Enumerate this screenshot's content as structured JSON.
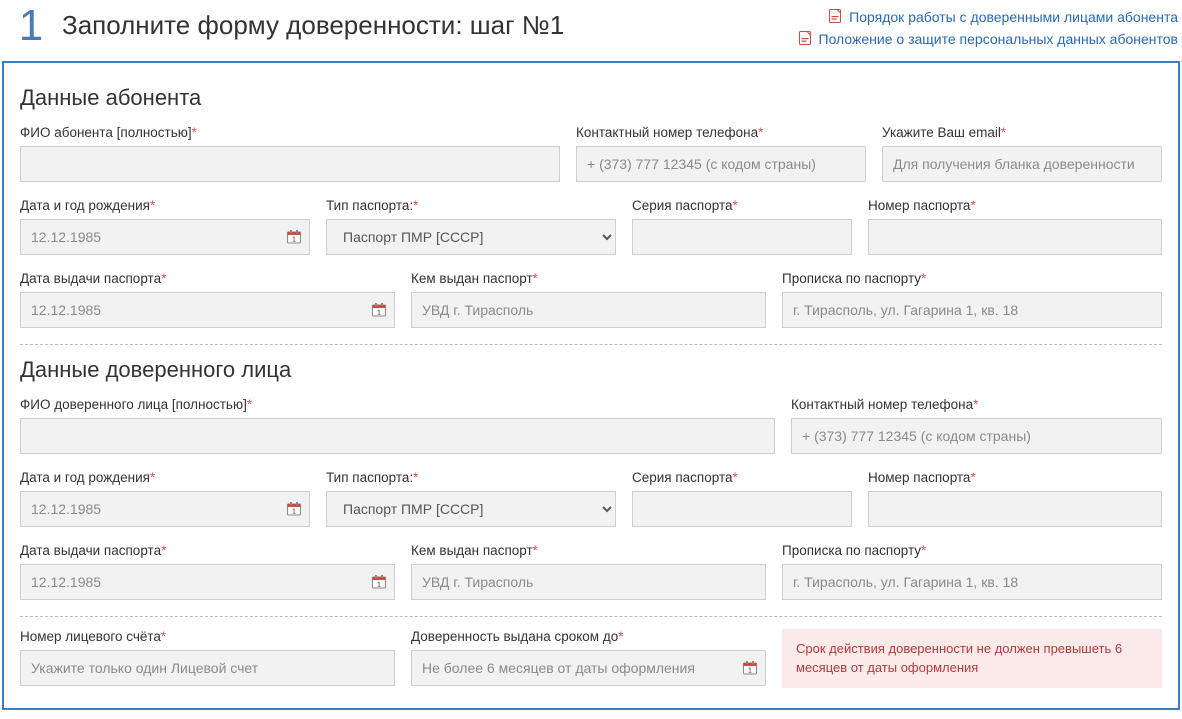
{
  "header": {
    "step": "1",
    "title": "Заполните форму доверенности: шаг №1",
    "links": [
      "Порядок работы с доверенными лицами абонента",
      "Положение о защите персональных данных абонентов"
    ]
  },
  "sections": {
    "subscriber": "Данные абонента",
    "trustee": "Данные доверенного лица"
  },
  "labels": {
    "fio_subscriber": "ФИО абонента [полностью]",
    "phone": "Контактный номер телефона",
    "email": "Укажите Ваш email",
    "dob": "Дата и год рождения",
    "passport_type": "Тип паспорта:",
    "passport_series": "Серия паспорта",
    "passport_number": "Номер паспорта",
    "passport_issue_date": "Дата выдачи паспорта",
    "passport_issued_by": "Кем выдан паспорт",
    "passport_registration": "Прописка по паспорту",
    "fio_trustee": "ФИО доверенного лица [полностью]",
    "account": "Номер лицевого счёта",
    "valid_until": "Доверенность выдана сроком до"
  },
  "placeholders": {
    "phone": "+ (373) 777 12345 (с кодом страны)",
    "email": "Для получения бланка доверенности",
    "dob": "12.12.1985",
    "passport_issue_date": "12.12.1985",
    "passport_issued_by": "УВД г. Тирасполь",
    "passport_registration": "г. Тирасполь, ул. Гагарина 1, кв. 18",
    "account": "Укажите только один Лицевой счет",
    "valid_until": "Не более 6 месяцев от даты оформления"
  },
  "passport_type_option": "Паспорт ПМР [СССР]",
  "alert": "Срок действия доверенности не должен превышеть 6 месяцев от даты оформления"
}
